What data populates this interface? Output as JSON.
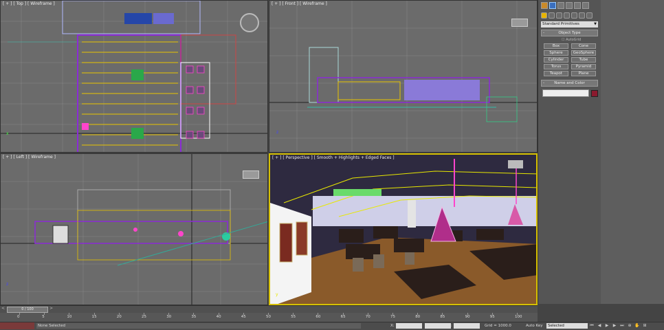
{
  "viewports": {
    "top": {
      "label": "[ + ] [ Top ] [ Wireframe ]"
    },
    "front": {
      "label": "[ + ] [ Front ] [ Wireframe ]"
    },
    "left": {
      "label": "[ + ] [ Left ] [ Wireframe ]"
    },
    "perspective": {
      "label": "[ + ] [ Perspective ] [ Smooth + Highlights + Edged Faces ]"
    }
  },
  "command_panel": {
    "dropdown": "Standard Primitives",
    "object_type": "Object Type",
    "autogrid": "AutoGrid",
    "buttons": [
      "Box",
      "Cone",
      "Sphere",
      "GeoSphere",
      "Cylinder",
      "Tube",
      "Torus",
      "Pyramid",
      "Teapot",
      "Plane"
    ],
    "name_and_color": "Name and Color",
    "color": "#8b1a2e"
  },
  "time_slider": {
    "frame": "0 / 100"
  },
  "trackbar": {
    "ticks": [
      "0",
      "5",
      "10",
      "15",
      "20",
      "25",
      "30",
      "35",
      "40",
      "45",
      "50",
      "55",
      "60",
      "65",
      "70",
      "75",
      "80",
      "85",
      "90",
      "95",
      "100"
    ]
  },
  "status": {
    "selection": "None Selected",
    "x_label": "X:",
    "y_label": "Y:",
    "z_label": "Z:",
    "grid": "Grid = 1000.0",
    "auto_key": "Auto Key",
    "selected": "Selected"
  },
  "colors": {
    "viewport_bg": "#6b6b6b",
    "active_border": "#d6c000",
    "perspective_ceiling": "#2e2a40",
    "floor": "#8a5a2a"
  }
}
